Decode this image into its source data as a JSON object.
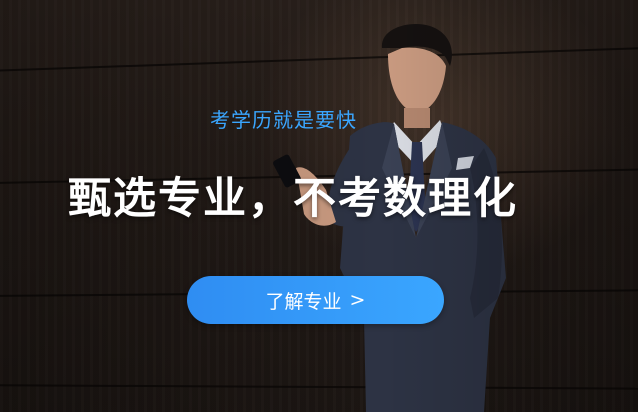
{
  "banner": {
    "subtitle": "考学历就是要快",
    "headline": "甄选专业，不考数理化",
    "cta_label": "了解专业",
    "cta_arrow": ">"
  },
  "colors": {
    "accent": "#3aa6ff",
    "cta_start": "#2f8df2",
    "cta_end": "#3aa6ff",
    "headline": "#ffffff"
  },
  "icons": {
    "cta_arrow": "chevron-right-icon"
  }
}
